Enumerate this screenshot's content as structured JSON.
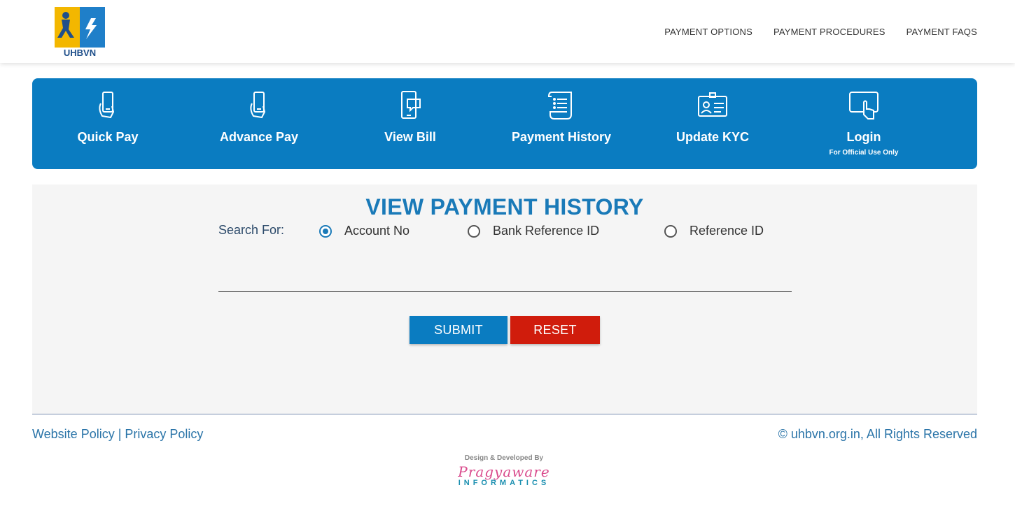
{
  "header": {
    "logo_text": "UHBVN",
    "nav": [
      "PAYMENT OPTIONS",
      "PAYMENT PROCEDURES",
      "PAYMENT FAQS"
    ]
  },
  "actions": [
    {
      "label": "Quick Pay",
      "icon": "phone-hand-icon"
    },
    {
      "label": "Advance Pay",
      "icon": "phone-hand-icon"
    },
    {
      "label": "View Bill",
      "icon": "mobile-message-icon"
    },
    {
      "label": "Payment History",
      "icon": "scroll-list-icon"
    },
    {
      "label": "Update KYC",
      "icon": "id-card-icon"
    },
    {
      "label": "Login",
      "sub": "For Official Use Only",
      "icon": "tablet-touch-icon"
    }
  ],
  "panel": {
    "title": "VIEW PAYMENT HISTORY",
    "search_label": "Search For:",
    "options": [
      "Account No",
      "Bank Reference ID",
      "Reference ID"
    ],
    "selected": "Account No",
    "input_value": "",
    "submit_label": "SUBMIT",
    "reset_label": "RESET"
  },
  "footer": {
    "website_policy": "Website Policy",
    "separator": " | ",
    "privacy_policy": "Privacy Policy",
    "copyright": "© uhbvn.org.in, All Rights Reserved",
    "credit_line": "Design & Developed By",
    "credit_brand": "Pragyaware",
    "credit_sub": "INFORMATICS"
  },
  "colors": {
    "brand_blue": "#0a7cc1",
    "reset_red": "#d01c0c",
    "title_blue": "#1a7ab8"
  }
}
